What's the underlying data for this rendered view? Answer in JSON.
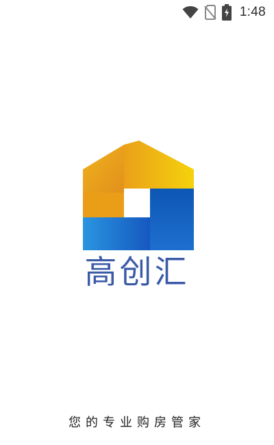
{
  "status_bar": {
    "time": "1:48",
    "icons": [
      "wifi-icon",
      "no-sim-icon",
      "battery-charging-icon"
    ]
  },
  "splash": {
    "brand_name": "高创汇",
    "tagline": "您的专业购房管家"
  },
  "colors": {
    "background": "#ffffff",
    "brand_text": "#3b5aa8",
    "logo_orange": "#e8a21b",
    "logo_yellow": "#f2c80f",
    "logo_blue": "#1564c0",
    "logo_light_blue": "#1e88d8",
    "status_icons": "#444444"
  }
}
